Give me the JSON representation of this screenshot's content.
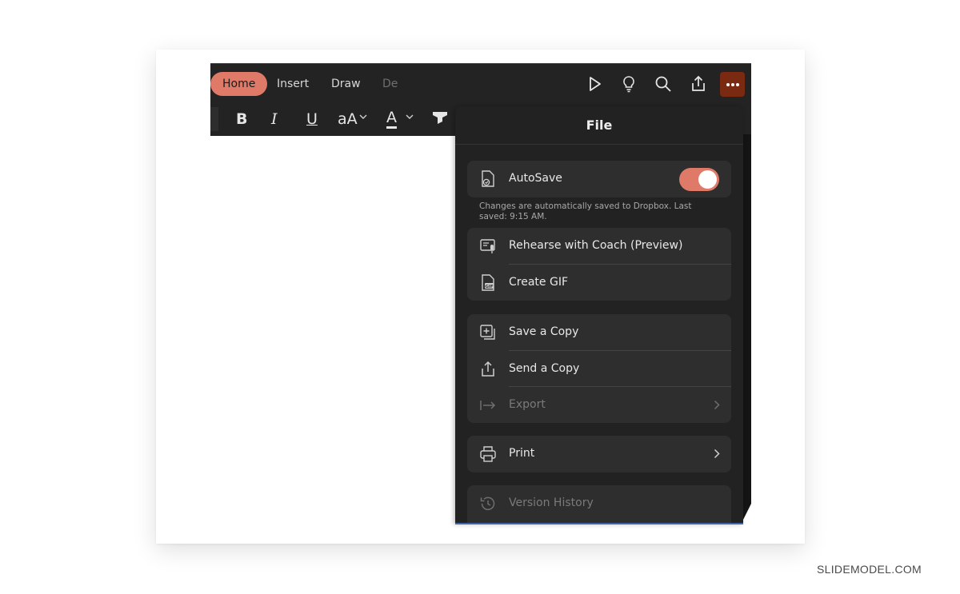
{
  "tabs": [
    {
      "label": "Home"
    },
    {
      "label": "Insert"
    },
    {
      "label": "Draw"
    },
    {
      "label": "De"
    }
  ],
  "format_toolbar": {
    "bold": "B",
    "italic": "I",
    "underline": "U",
    "font_size": "aA",
    "font_color": "A"
  },
  "ribbon_icons": [
    "play-icon",
    "lightbulb-icon",
    "search-icon",
    "share-icon",
    "more-icon"
  ],
  "file_panel": {
    "title": "File",
    "autosave": {
      "label": "AutoSave",
      "enabled": true,
      "note": "Changes are automatically saved to Dropbox. Last saved: 9:15 AM."
    },
    "group1": [
      {
        "label": "Rehearse with Coach (Preview)",
        "icon": "coach-icon"
      },
      {
        "label": "Create GIF",
        "icon": "gif-file-icon"
      }
    ],
    "group2": [
      {
        "label": "Save a Copy",
        "icon": "save-copy-icon"
      },
      {
        "label": "Send a Copy",
        "icon": "send-copy-icon"
      },
      {
        "label": "Export",
        "icon": "export-icon",
        "disabled": true
      }
    ],
    "print": {
      "label": "Print",
      "icon": "printer-icon"
    },
    "version_history": {
      "label": "Version History",
      "icon": "history-icon",
      "disabled": true
    }
  },
  "colors": {
    "accent": "#e07a68",
    "more_button": "#7b2a12",
    "panel_bg": "#222222",
    "group_bg": "#2e2e2e"
  },
  "watermark": "SLIDEMODEL.COM"
}
